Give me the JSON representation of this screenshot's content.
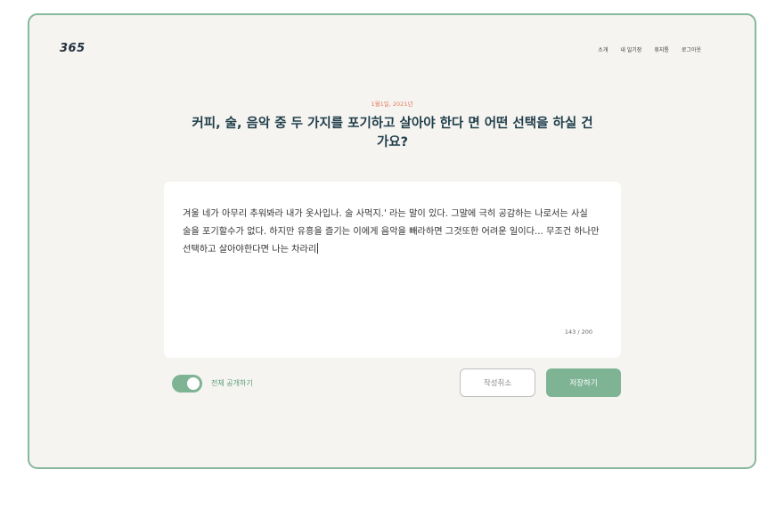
{
  "app": {
    "logo": "365"
  },
  "nav": {
    "items": [
      "소개",
      "내 일기장",
      "휴지통",
      "로그아웃"
    ]
  },
  "entry": {
    "date": "1월1일, 2021년",
    "question": "커피, 술, 음악 중 두 가지를 포기하고 살아야 한다 면 어떤 선택을 하실 건가요?",
    "text": "겨울 네가 아무리 추워봐라 내가 옷사입나. 술 사먹지.' 라는 말이 있다. 그말에 극히 공감하는 나로서는 사실 술을 포기할수가 없다. 하지만 유흥을 즐기는 이에게 음악을 빼라하면 그것또한 어려운 일이다... 무조건 하나만 선택하고 살아야한다면 나는 차라리",
    "counter": "143 / 200"
  },
  "controls": {
    "public_toggle_label": "전체 공개하기",
    "public_toggle_on": true,
    "cancel_label": "작성취소",
    "save_label": "저장하기"
  },
  "colors": {
    "accent_green": "#7eb394",
    "frame_border": "#86b89c",
    "date_color": "#e8775f",
    "title_color": "#1f3d4a"
  }
}
